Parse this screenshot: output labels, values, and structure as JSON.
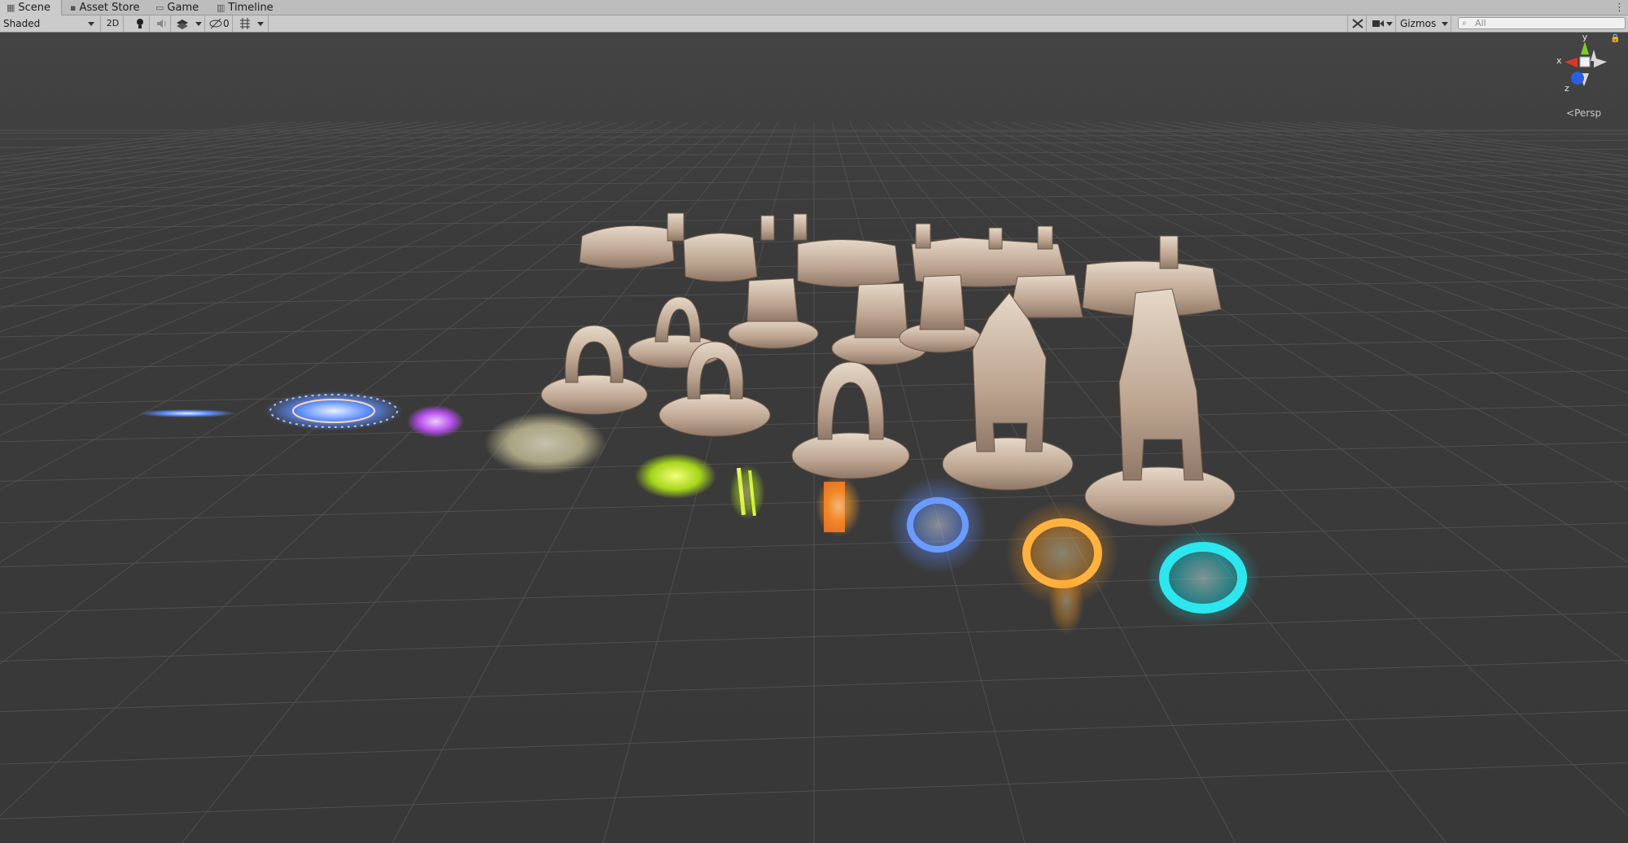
{
  "tabs": [
    {
      "label": "Scene",
      "icon": "scene-grid-icon",
      "active": true
    },
    {
      "label": "Asset Store",
      "icon": "asset-store-bag-icon",
      "active": false
    },
    {
      "label": "Game",
      "icon": "gamepad-icon",
      "active": false
    },
    {
      "label": "Timeline",
      "icon": "timeline-icon",
      "active": false
    }
  ],
  "toolbar": {
    "draw_mode": "Shaded",
    "mode_2d": "2D",
    "hidden_count": "0",
    "gizmos": "Gizmos",
    "search_placeholder": "All"
  },
  "orientation_gizmo": {
    "axis_x": "x",
    "axis_y": "y",
    "axis_z": "z",
    "projection": "Persp"
  },
  "colors": {
    "viewport_bg": "#3a3a3a",
    "toolbar_bg": "#cbcbcb",
    "axis_x": "#e0342b",
    "axis_y": "#7fcc28",
    "axis_z": "#2b5fe0",
    "stone": "#cdb8a6"
  },
  "scene_objects": {
    "stone_structures": [
      "stone-arch",
      "stone-arch",
      "stone-arch",
      "stone-ring",
      "stone-tower",
      "stone-tower"
    ],
    "vfx": [
      "blue-spark-trail",
      "blue-magic-circle",
      "purple-sparkles",
      "white-sparkles",
      "green-smoke",
      "yellow-light-bars",
      "orange-fire-bars",
      "blue-portal",
      "orange-portal",
      "cyan-portal"
    ]
  }
}
